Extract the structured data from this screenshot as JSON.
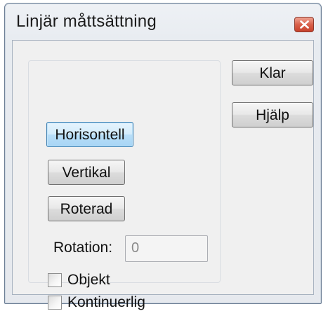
{
  "window": {
    "title": "Linjär måttsättning"
  },
  "buttons": {
    "horisontell": "Horisontell",
    "vertikal": "Vertikal",
    "roterad": "Roterad",
    "klar": "Klar",
    "hjalp": "Hjälp"
  },
  "rotation": {
    "label": "Rotation:",
    "value": "0"
  },
  "checkboxes": [
    {
      "label": "Objekt",
      "checked": false
    },
    {
      "label": "Kontinuerlig",
      "checked": false
    }
  ],
  "colors": {
    "active_button": "#b8def8",
    "close_button": "#d8604a"
  },
  "icons": {
    "close": "close-icon"
  }
}
